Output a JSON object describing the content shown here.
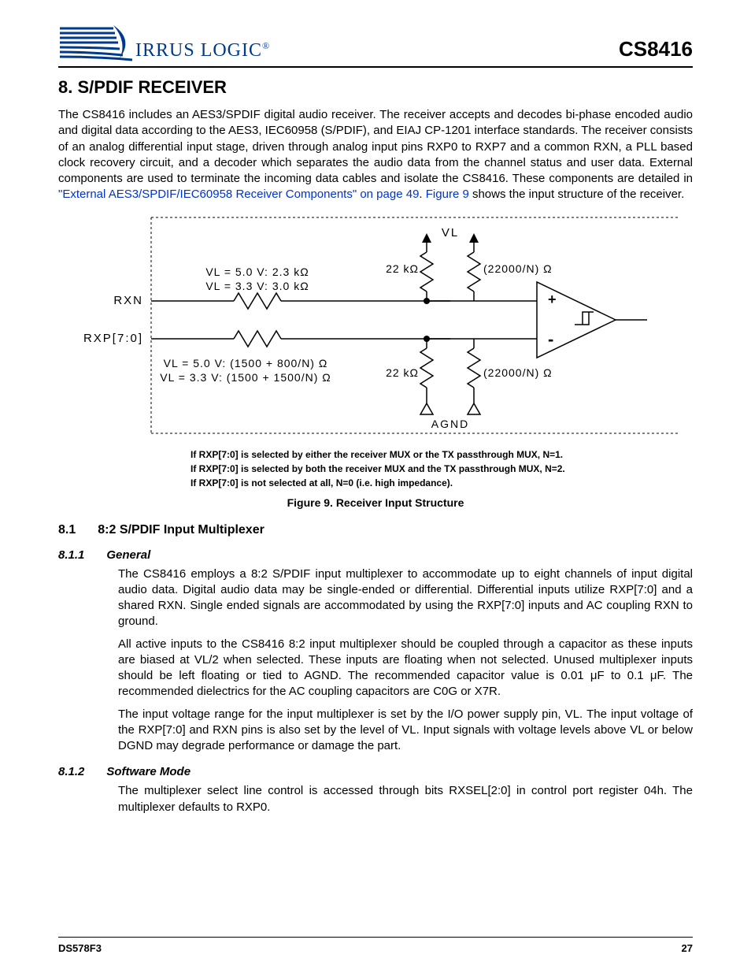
{
  "header": {
    "brand_text": "IRRUS LOGIC",
    "brand_reg": "®",
    "part_number": "CS8416"
  },
  "chapter": {
    "number_title": "8.  S/PDIF RECEIVER"
  },
  "intro": {
    "p1_a": "The CS8416 includes an AES3/SPDIF digital audio receiver. The receiver accepts and decodes bi-phase encoded audio and digital data according to the AES3, IEC60958 (S/PDIF), and EIAJ CP-1201 interface standards. The receiver consists of an analog differential input stage, driven through analog input pins RXP0 to RXP7 and a common RXN, a PLL based clock recovery circuit, and a decoder which separates the audio data from the channel status and user data. External components are used to terminate the incoming data cables and isolate the CS8416. These components are detailed in ",
    "link1": "\"External AES3/SPDIF/IEC60958 Receiver Components\" on page 49",
    "p1_b": ". ",
    "link2": "Figure 9",
    "p1_c": " shows the input structure of the receiver."
  },
  "figure9": {
    "rxn_label": "RXN",
    "rxp_label": "RXP[7:0]",
    "vl_top": "VL",
    "vl5_top": "VL = 5.0 V: 2.3 kΩ",
    "vl33_top": "VL = 3.3 V: 3.0 kΩ",
    "vl5_bot": "VL = 5.0 V: (1500 + 800/N) Ω",
    "vl33_bot": "VL = 3.3 V: (1500 + 1500/N) Ω",
    "r22k_1": "22 kΩ",
    "r22k_2": "22 kΩ",
    "rN_1": "(22000/N) Ω",
    "rN_2": "(22000/N) Ω",
    "agnd": "AGND",
    "plus": "+",
    "minus": "-",
    "note1": "If RXP[7:0] is selected by either the receiver MUX or the TX passthrough MUX, N=1.",
    "note2": "If RXP[7:0] is selected by both the receiver MUX and the TX passthrough MUX, N=2.",
    "note3": "If RXP[7:0] is not selected at all, N=0 (i.e. high impedance).",
    "caption": "Figure 9.  Receiver Input Structure"
  },
  "sec81": {
    "num": "8.1",
    "title": "8:2 S/PDIF Input Multiplexer"
  },
  "sec811": {
    "num": "8.1.1",
    "title": "General",
    "p1": "The CS8416 employs a 8:2 S/PDIF input multiplexer to accommodate up to eight channels of input digital audio data. Digital audio data may be single-ended or differential. Differential inputs utilize RXP[7:0] and a shared RXN. Single ended signals are accommodated by using the RXP[7:0] inputs and AC coupling RXN to ground.",
    "p2": "All active inputs to the CS8416 8:2 input multiplexer should be coupled through a capacitor as these inputs are biased at VL/2 when selected. These inputs are floating when not selected. Unused multiplexer inputs should be left floating or tied to AGND. The recommended capacitor value is 0.01 μF to 0.1 μF. The recommended dielectrics for the AC coupling capacitors are C0G or X7R.",
    "p3": "The input voltage range for the input multiplexer is set by the I/O power supply pin, VL. The input voltage of the RXP[7:0] and RXN pins is also set by the level of VL. Input signals with voltage levels above VL or below DGND may degrade performance or damage the part."
  },
  "sec812": {
    "num": "8.1.2",
    "title": "Software Mode",
    "p1": "The multiplexer select line control is accessed through bits RXSEL[2:0] in control port register 04h. The multiplexer defaults to RXP0."
  },
  "footer": {
    "doc_id": "DS578F3",
    "page_num": "27"
  }
}
